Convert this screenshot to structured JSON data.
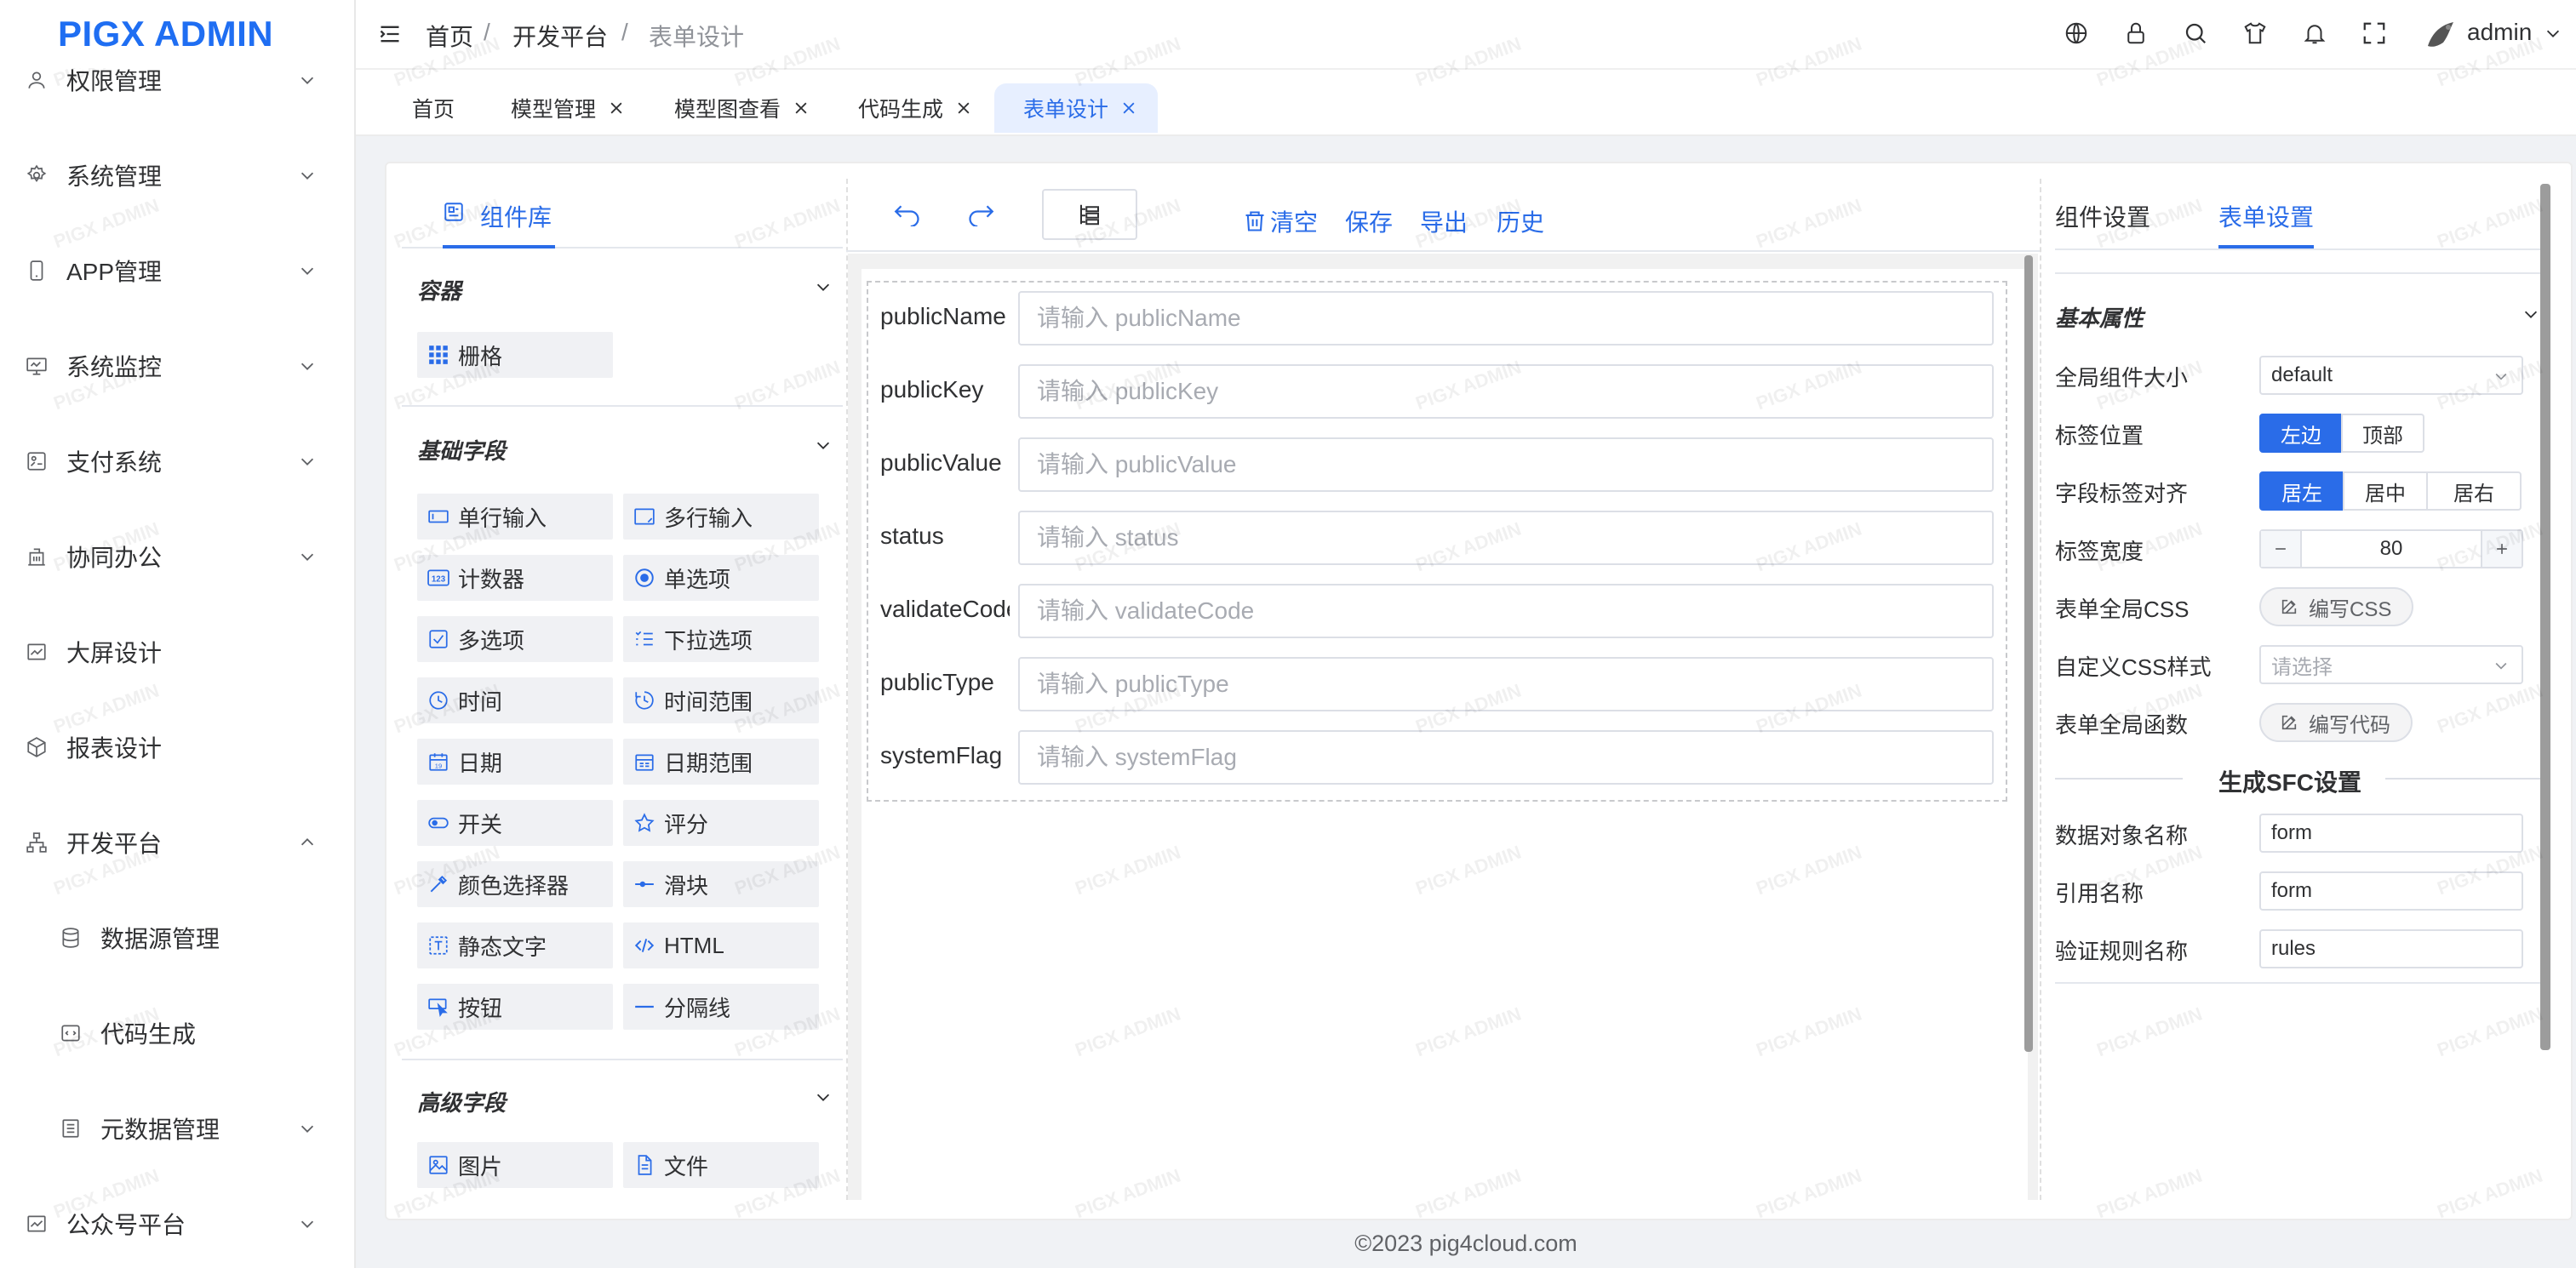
{
  "app": {
    "logo": "PIGX ADMIN",
    "watermark": "PIGX ADMIN"
  },
  "sidebar": {
    "items": [
      {
        "label": "权限管理",
        "icon": "user-icon",
        "expanded": false
      },
      {
        "label": "系统管理",
        "icon": "gear-icon",
        "expanded": false
      },
      {
        "label": "APP管理",
        "icon": "phone-icon",
        "expanded": false
      },
      {
        "label": "系统监控",
        "icon": "monitor-icon",
        "expanded": false
      },
      {
        "label": "支付系统",
        "icon": "payment-icon",
        "expanded": false
      },
      {
        "label": "协同办公",
        "icon": "building-icon",
        "expanded": false
      },
      {
        "label": "大屏设计",
        "icon": "dashboard-icon",
        "expanded": false
      },
      {
        "label": "报表设计",
        "icon": "cube-icon",
        "expanded": false
      },
      {
        "label": "开发平台",
        "icon": "org-icon",
        "expanded": true
      },
      {
        "label": "数据源管理",
        "icon": "database-icon",
        "sub": true
      },
      {
        "label": "代码生成",
        "icon": "code-icon",
        "sub": true
      },
      {
        "label": "元数据管理",
        "icon": "list-icon",
        "sub": true,
        "expanded": false
      },
      {
        "label": "公众号平台",
        "icon": "chart-icon",
        "expanded": false
      }
    ]
  },
  "header": {
    "breadcrumb": [
      "首页",
      "开发平台",
      "表单设计"
    ],
    "separator": "/",
    "user": "admin"
  },
  "tabs": [
    {
      "label": "首页",
      "closable": false,
      "active": false
    },
    {
      "label": "模型管理",
      "closable": true,
      "active": false
    },
    {
      "label": "模型图查看",
      "closable": true,
      "active": false
    },
    {
      "label": "代码生成",
      "closable": true,
      "active": false
    },
    {
      "label": "表单设计",
      "closable": true,
      "active": true
    }
  ],
  "components_panel": {
    "tab": "组件库",
    "groups": [
      {
        "title": "容器",
        "items": [
          "栅格"
        ]
      },
      {
        "title": "基础字段",
        "items": [
          "单行输入",
          "多行输入",
          "计数器",
          "单选项",
          "多选项",
          "下拉选项",
          "时间",
          "时间范围",
          "日期",
          "日期范围",
          "开关",
          "评分",
          "颜色选择器",
          "滑块",
          "静态文字",
          "HTML",
          "按钮",
          "分隔线"
        ]
      },
      {
        "title": "高级字段",
        "items": [
          "图片",
          "文件"
        ]
      }
    ]
  },
  "toolbar": {
    "clear": "清空",
    "save": "保存",
    "export": "导出",
    "history": "历史"
  },
  "form_fields": [
    {
      "label": "publicName",
      "placeholder": "请输入 publicName"
    },
    {
      "label": "publicKey",
      "placeholder": "请输入 publicKey"
    },
    {
      "label": "publicValue",
      "placeholder": "请输入 publicValue"
    },
    {
      "label": "status",
      "placeholder": "请输入 status"
    },
    {
      "label": "validateCode",
      "placeholder": "请输入 validateCode"
    },
    {
      "label": "publicType",
      "placeholder": "请输入 publicType"
    },
    {
      "label": "systemFlag",
      "placeholder": "请输入 systemFlag"
    }
  ],
  "settings_panel": {
    "tabs": [
      "组件设置",
      "表单设置"
    ],
    "active_tab": "表单设置",
    "section_title": "基本属性",
    "rows": {
      "size_label": "全局组件大小",
      "size_value": "default",
      "label_pos_label": "标签位置",
      "label_pos_options": [
        "左边",
        "顶部"
      ],
      "label_pos_selected": "左边",
      "label_align_label": "字段标签对齐",
      "label_align_options": [
        "居左",
        "居中",
        "居右"
      ],
      "label_align_selected": "居左",
      "label_width_label": "标签宽度",
      "label_width_value": "80",
      "global_css_label": "表单全局CSS",
      "global_css_button": "编写CSS",
      "custom_css_label": "自定义CSS样式",
      "custom_css_placeholder": "请选择",
      "global_func_label": "表单全局函数",
      "global_func_button": "编写代码"
    },
    "sfc_title": "生成SFC设置",
    "sfc": {
      "data_obj_label": "数据对象名称",
      "data_obj_value": "form",
      "ref_label": "引用名称",
      "ref_value": "form",
      "rules_label": "验证规则名称",
      "rules_value": "rules"
    }
  },
  "footer": {
    "copyright": "©2023 pig4cloud.com"
  },
  "colors": {
    "primary": "#2a6ce8",
    "logo": "#1f6ef2"
  }
}
